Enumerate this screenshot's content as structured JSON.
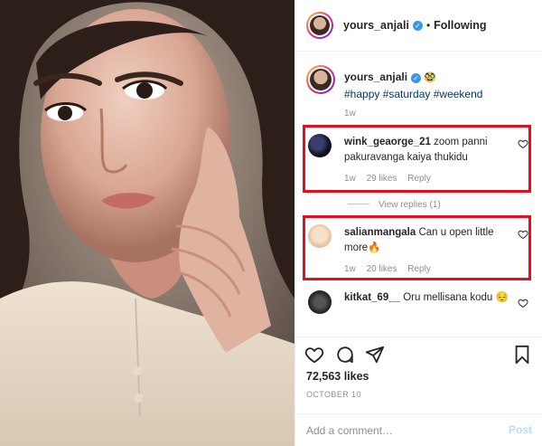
{
  "post": {
    "username": "yours_anjali",
    "follow_status": "Following",
    "separator": "•",
    "verified_glyph": "✓"
  },
  "caption": {
    "username": "yours_anjali",
    "emoji": "🥸",
    "hashtags": "#happy #saturday #weekend",
    "time": "1w"
  },
  "comments": [
    {
      "username": "wink_geaorge_21",
      "text": "zoom panni pakuravanga kaiya thukidu",
      "time": "1w",
      "likes": "29 likes",
      "reply": "Reply",
      "highlighted": true
    },
    {
      "username": "salianmangala",
      "text": "Can u open little more🔥",
      "time": "1w",
      "likes": "20 likes",
      "reply": "Reply",
      "highlighted": true
    },
    {
      "username": "kitkat_69__",
      "text": "Oru mellisana kodu 😔",
      "highlighted": false
    }
  ],
  "view_replies": "View replies (1)",
  "engagement": {
    "likes": "72,563 likes",
    "date": "OCTOBER 10"
  },
  "add_comment": {
    "placeholder": "Add a comment…",
    "post_label": "Post"
  },
  "colors": {
    "highlight": "#e3101b",
    "link": "#00376b",
    "verified": "#3897f0",
    "post_button": "#b2dffc"
  },
  "icons": [
    "heart-icon",
    "comment-icon",
    "share-icon",
    "bookmark-icon",
    "verified-icon"
  ]
}
